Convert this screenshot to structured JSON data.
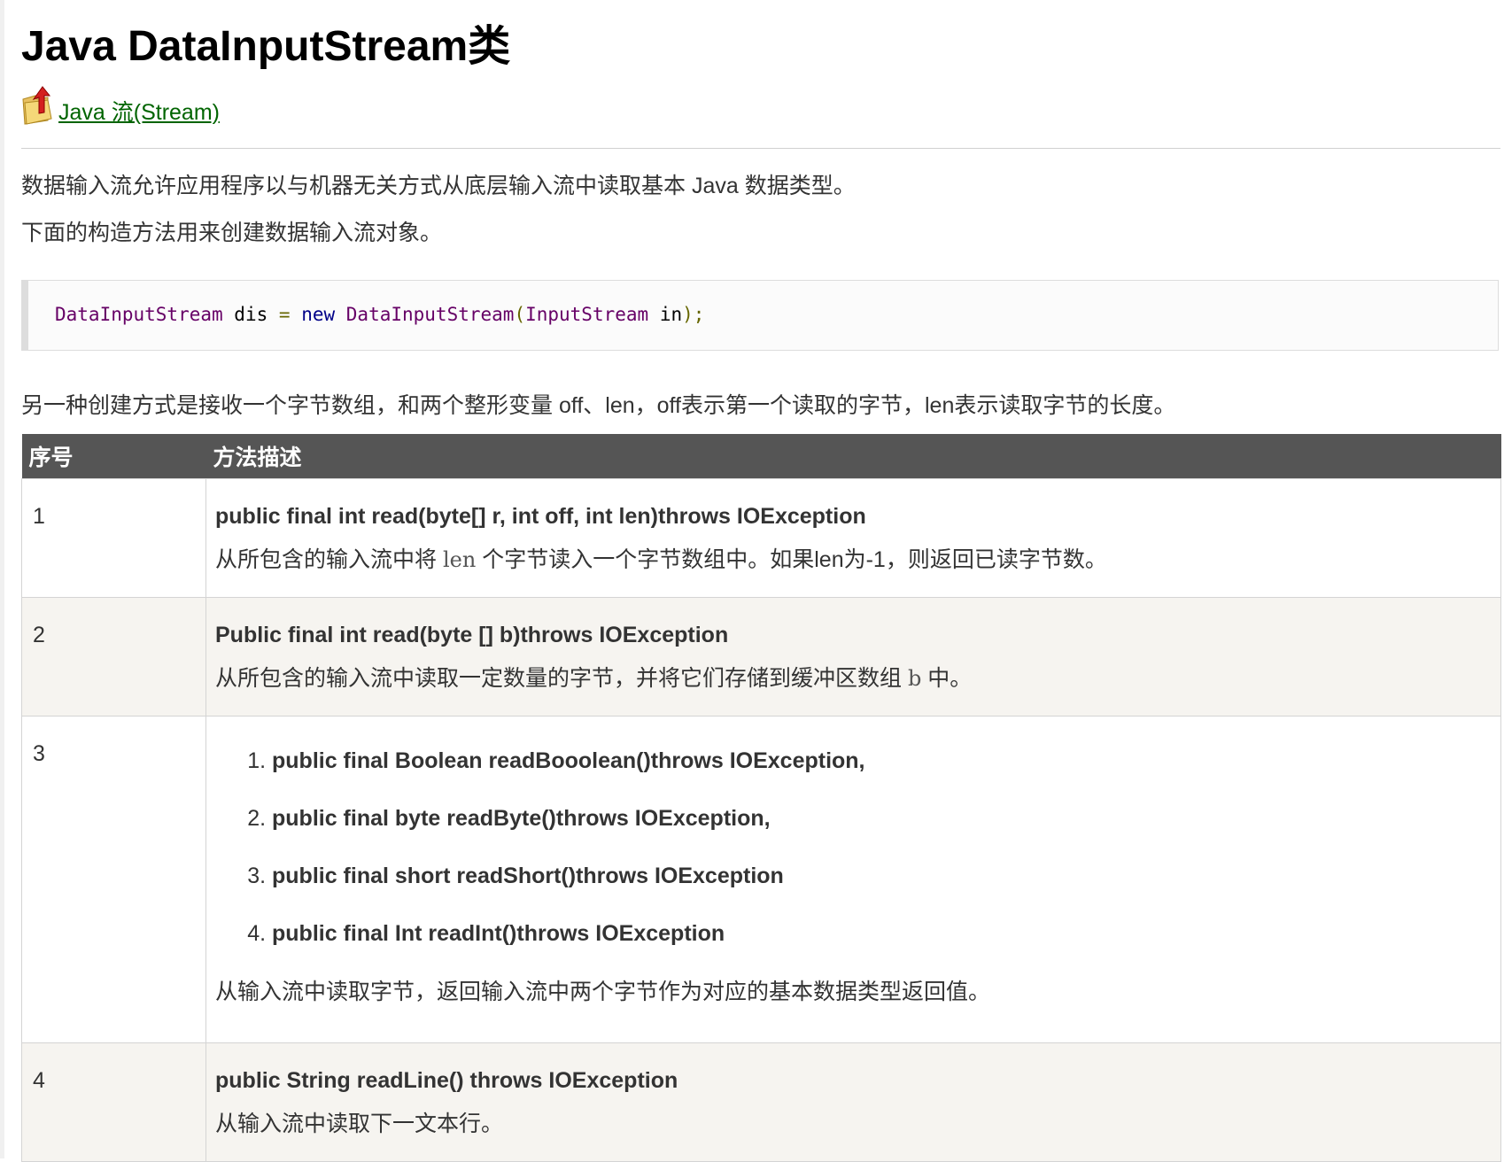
{
  "page": {
    "title": "Java DataInputStream类",
    "back_link": "Java 流(Stream)",
    "intro_1": "数据输入流允许应用程序以与机器无关方式从底层输入流中读取基本 Java 数据类型。",
    "intro_2": "下面的构造方法用来创建数据输入流对象。",
    "code": {
      "type_1": "DataInputStream",
      "var": " dis ",
      "eq": "=",
      "kw_new": "new",
      "type_2": "DataInputStream",
      "paren_open": "(",
      "type_3": "InputStream",
      "param": " in",
      "paren_close": ");"
    },
    "intro_3": "另一种创建方式是接收一个字节数组，和两个整形变量 off、len，off表示第一个读取的字节，len表示读取字节的长度。"
  },
  "table": {
    "headers": [
      "序号",
      "方法描述"
    ],
    "rows": [
      {
        "num": "1",
        "signature": "public final int read(byte[] r, int off, int len)throws IOException",
        "note_pre": "从所包含的输入流中将 ",
        "note_code": "len",
        "note_post": " 个字节读入一个字节数组中。如果len为-1，则返回已读字节数。"
      },
      {
        "num": "2",
        "signature": "Public final int read(byte [] b)throws IOException",
        "note_pre": "从所包含的输入流中读取一定数量的字节，并将它们存储到缓冲区数组 ",
        "note_code": "b",
        "note_post": " 中。"
      },
      {
        "num": "3",
        "list": [
          "public final Boolean readBooolean()throws IOException,",
          "public final byte readByte()throws IOException,",
          "public final short readShort()throws IOException",
          "public final Int readInt()throws IOException"
        ],
        "note": "从输入流中读取字节，返回输入流中两个字节作为对应的基本数据类型返回值。"
      },
      {
        "num": "4",
        "signature": "public String readLine() throws IOException",
        "note": "从输入流中读取下一文本行。"
      }
    ]
  },
  "colors": {
    "link": "#006400",
    "table_header_bg": "#555555",
    "alt_row_bg": "#f6f4f0",
    "code_type": "#660066",
    "code_keyword": "#000088",
    "code_punct": "#666600"
  }
}
